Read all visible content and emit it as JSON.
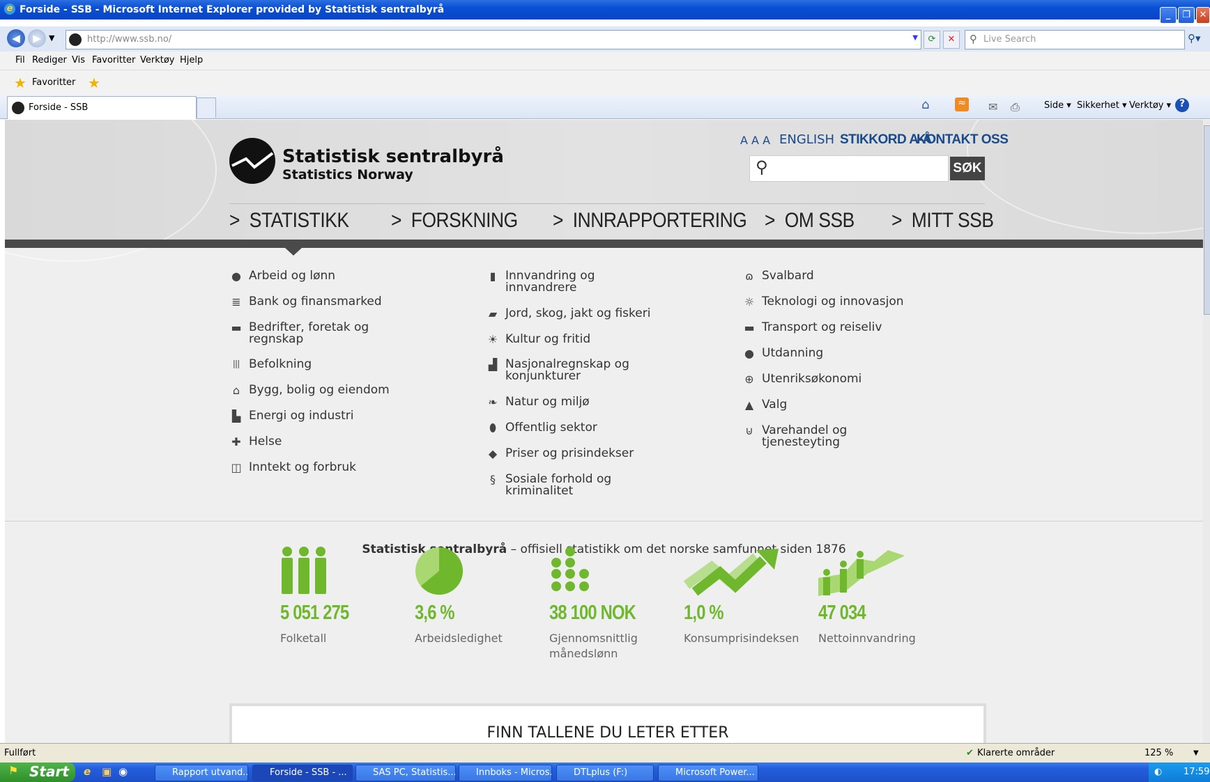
{
  "window": {
    "title": "Forside - SSB - Microsoft Internet Explorer provided by Statistisk sentralbyrå"
  },
  "address_bar": {
    "url": "http://www.ssb.no/",
    "search_placeholder": "Live Search"
  },
  "menu": [
    "Fil",
    "Rediger",
    "Vis",
    "Favoritter",
    "Verktøy",
    "Hjelp"
  ],
  "favorites_label": "Favoritter",
  "tab": {
    "label": "Forside - SSB"
  },
  "command_bar": {
    "page": "Side",
    "security": "Sikkerhet",
    "tools": "Verktøy"
  },
  "header": {
    "logo_name": "Statistisk sentralbyrå",
    "logo_sub": "Statistics Norway",
    "text_size": "A A A",
    "english": "ENGLISH",
    "index": "STIKKORD A-Å",
    "contact": "KONTAKT OSS",
    "search_button": "SØK"
  },
  "main_nav": [
    "STATISTIKK",
    "FORSKNING",
    "INNRAPPORTERING",
    "OM SSB",
    "MITT SSB"
  ],
  "categories": {
    "col1": [
      {
        "icon": "money-bag-icon",
        "label": "Arbeid og lønn"
      },
      {
        "icon": "bank-icon",
        "label": "Bank og finansmarked"
      },
      {
        "icon": "building-icon",
        "label": "Bedrifter, foretak og regnskap"
      },
      {
        "icon": "people-icon",
        "label": "Befolkning"
      },
      {
        "icon": "house-icon",
        "label": "Bygg, bolig og eiendom"
      },
      {
        "icon": "factory-icon",
        "label": "Energi og industri"
      },
      {
        "icon": "cross-icon",
        "label": "Helse"
      },
      {
        "icon": "wallet-icon",
        "label": "Inntekt og forbruk"
      }
    ],
    "col2": [
      {
        "icon": "passport-icon",
        "label": "Innvandring og innvandrere"
      },
      {
        "icon": "cow-icon",
        "label": "Jord, skog, jakt og fiskeri"
      },
      {
        "icon": "sun-icon",
        "label": "Kultur og fritid"
      },
      {
        "icon": "chart-icon",
        "label": "Nasjonalregnskap og konjunkturer"
      },
      {
        "icon": "leaf-icon",
        "label": "Natur og miljø"
      },
      {
        "icon": "shield-icon",
        "label": "Offentlig sektor"
      },
      {
        "icon": "price-tag-icon",
        "label": "Priser og prisindekser"
      },
      {
        "icon": "paragraph-icon",
        "label": "Sosiale forhold og kriminalitet"
      }
    ],
    "col3": [
      {
        "icon": "polar-bear-icon",
        "label": "Svalbard"
      },
      {
        "icon": "lightbulb-icon",
        "label": "Teknologi og innovasjon"
      },
      {
        "icon": "suitcase-icon",
        "label": "Transport og reiseliv"
      },
      {
        "icon": "apple-icon",
        "label": "Utdanning"
      },
      {
        "icon": "globe-icon",
        "label": "Utenriksøkonomi"
      },
      {
        "icon": "ballot-icon",
        "label": "Valg"
      },
      {
        "icon": "basket-icon",
        "label": "Varehandel og tjenesteyting"
      }
    ]
  },
  "tagline": {
    "bold": "Statistisk sentralbyrå",
    "rest": " – offisiell statistikk om det norske samfunnet siden 1876"
  },
  "key_figures": [
    {
      "value": "5 051 275",
      "label": "Folketall"
    },
    {
      "value": "3,6 %",
      "label": "Arbeidsledighet",
      "pie_fraction": 0.64
    },
    {
      "value": "38 100 NOK",
      "label": "Gjennomsnittlig månedslønn"
    },
    {
      "value": "1,0 %",
      "label": "Konsumprisindeksen"
    },
    {
      "value": "47 034",
      "label": "Nettoinnvandring"
    }
  ],
  "finn_box": "FINN TALLENE DU LETER ETTER",
  "status_bar": {
    "status": "Fullført",
    "zone": "Klarerte områder",
    "zoom": "125 %"
  },
  "taskbar": {
    "start": "Start",
    "items": [
      "Rapport utvand...",
      "Forside - SSB - ...",
      "SAS PC, Statistis...",
      "Innboks - Micros...",
      "DTLplus (F:)",
      "Microsoft Power..."
    ],
    "clock": "17:59"
  },
  "colors": {
    "accent_green": "#6fb82d",
    "link_blue": "#1a4a8a",
    "nav_dark": "#4a4a4a"
  }
}
